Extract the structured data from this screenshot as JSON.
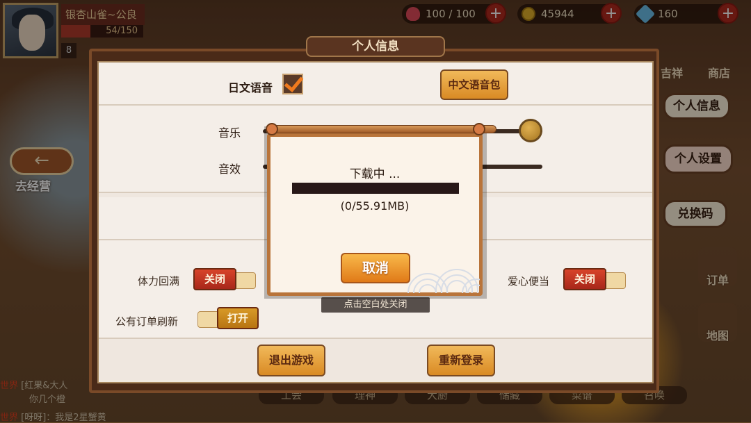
{
  "player": {
    "name": "银杏山雀~公良",
    "exp": "54/150",
    "exp_fraction": 0.36,
    "level": "8"
  },
  "resources": {
    "stamina": "100 / 100",
    "coins": "45944",
    "gems": "160",
    "plus": "+"
  },
  "side_menu": {
    "top_labels": [
      "吉祥",
      "商店"
    ],
    "personal_info": "个人信息",
    "personal_settings": "个人设置",
    "redeem_code": "兑换码",
    "orders": "订单",
    "map": "地图"
  },
  "left_nav": {
    "back_label": "去经营"
  },
  "panel": {
    "title": "个人信息",
    "japanese_voice_label": "日文语音",
    "japanese_voice_checked": true,
    "chinese_voice_pack": "中文语音包",
    "music_label": "音乐",
    "sfx_label": "音效",
    "music_volume": 1.0,
    "notifications": {
      "stamina_full": {
        "label": "体力回满",
        "state": "关闭"
      },
      "bento": {
        "label": "爱心便当",
        "state": "关闭"
      },
      "public_order_refresh": {
        "label": "公有订单刷新",
        "state": "打开"
      }
    },
    "logout": "退出游戏",
    "relogin": "重新登录"
  },
  "download_dialog": {
    "title": "下载中 ...",
    "progress": 0.0,
    "size_text": "(0/55.91MB)",
    "cancel": "取消",
    "close_hint": "点击空白处关闭"
  },
  "bottom_tabs": [
    "工会",
    "理神",
    "大厨",
    "储藏",
    "菜谱",
    "召唤"
  ],
  "chat": [
    {
      "channel": "世界",
      "text": "[红果&大人"
    },
    {
      "channel": "",
      "text": "你几个橙"
    },
    {
      "channel": "世界",
      "text": "[呀呀]：我是2星蟹黄"
    }
  ]
}
